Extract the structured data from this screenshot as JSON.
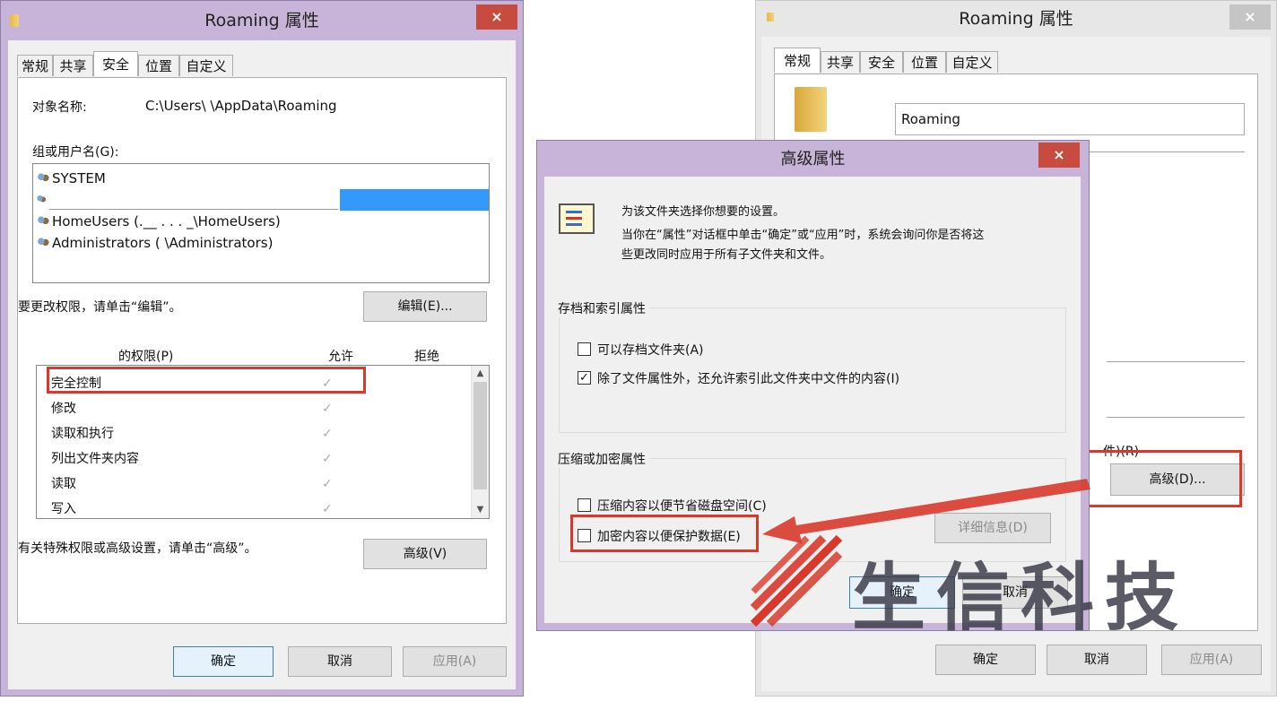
{
  "left_window": {
    "title": "Roaming 属性",
    "close": "×",
    "tabs": [
      "常规",
      "共享",
      "安全",
      "位置",
      "自定义"
    ],
    "object_name_label": "对象名称:",
    "object_name_value": "C:\\Users\\          \\AppData\\Roaming",
    "group_label": "组或用户名(G):",
    "users": [
      "SYSTEM",
      "",
      "HomeUsers (.__ . . . _\\HomeUsers)",
      "Administrators (               \\Administrators)"
    ],
    "change_hint": "要更改权限，请单击“编辑”。",
    "edit_button": "编辑(E)...",
    "perm_header": "的权限(P)",
    "allow_header": "允许",
    "deny_header": "拒绝",
    "permissions": [
      {
        "name": "完全控制",
        "allow": "✓"
      },
      {
        "name": "修改",
        "allow": "✓"
      },
      {
        "name": "读取和执行",
        "allow": "✓"
      },
      {
        "name": "列出文件夹内容",
        "allow": "✓"
      },
      {
        "name": "读取",
        "allow": "✓"
      },
      {
        "name": "写入",
        "allow": "✓"
      }
    ],
    "special_hint": "有关特殊权限或高级设置，请单击“高级”。",
    "advanced_button": "高级(V)",
    "ok": "确定",
    "cancel": "取消",
    "apply": "应用(A)"
  },
  "right_window": {
    "title": "Roaming 属性",
    "close": "×",
    "tabs": [
      "常规",
      "共享",
      "安全",
      "位置",
      "自定义"
    ],
    "name_value": "Roaming",
    "attr_partial": "件)(R)",
    "advanced_button": "高级(D)...",
    "ok": "确定",
    "cancel": "取消",
    "apply": "应用(A)"
  },
  "advanced_dialog": {
    "title": "高级属性",
    "close": "×",
    "intro_line1": "为该文件夹选择你想要的设置。",
    "intro_line2": "当你在“属性”对话框中单击“确定”或“应用”时，系统会询问你是否将这",
    "intro_line3": "些更改同时应用于所有子文件夹和文件。",
    "archive_group": "存档和索引属性",
    "archive_opt": "可以存档文件夹(A)",
    "index_opt": "除了文件属性外，还允许索引此文件夹中文件的内容(I)",
    "compress_group": "压缩或加密属性",
    "compress_opt": "压缩内容以便节省磁盘空间(C)",
    "encrypt_opt": "加密内容以便保护数据(E)",
    "details_button": "详细信息(D)",
    "ok": "确定",
    "cancel": "取消",
    "checks": {
      "archive": "",
      "index": "✓",
      "compress": "",
      "encrypt": ""
    }
  },
  "watermark": {
    "text": "生信科技"
  },
  "colors": {
    "accent_red": "#d8392c",
    "close_red": "#c84b3f",
    "selection_blue": "#3399ff"
  }
}
